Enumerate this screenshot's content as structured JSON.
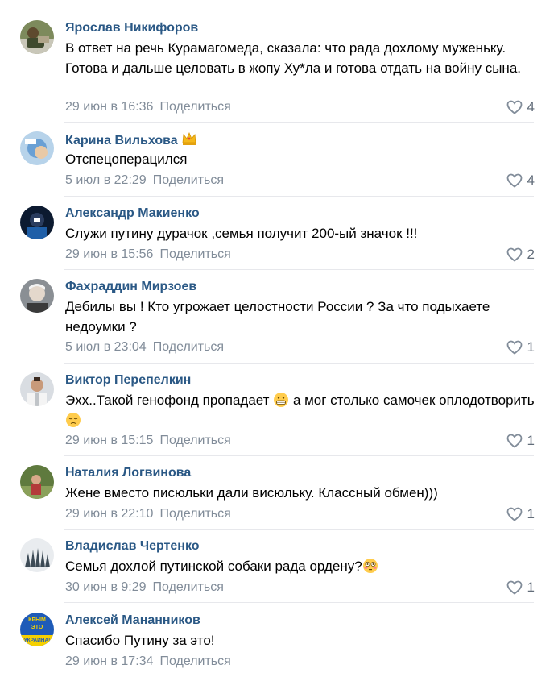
{
  "comments": [
    {
      "author": "Ярослав Никифоров",
      "text": "В ответ на речь Курамагомеда, сказала: что рада дохлому муженьку. Готова и дальше целовать в жопу Ху*ла и готова отдать на войну сына.",
      "date": "29 июн в 16:36",
      "share": "Поделиться",
      "likes": "4"
    },
    {
      "author": "Карина Вильхова",
      "text": "Отспецоперацился",
      "date": "5 июл в 22:29",
      "share": "Поделиться",
      "likes": "4"
    },
    {
      "author": "Александр Макиенко",
      "text": "Служи путину дурачок ,семья получит 200-ый значок !!!",
      "date": "29 июн в 15:56",
      "share": "Поделиться",
      "likes": "2"
    },
    {
      "author": "Фахраддин Мирзоев",
      "text": "Дебилы вы ! Кто угрожает целостности России ? За что подыхаете недоумки ?",
      "date": "5 июл в 23:04",
      "share": "Поделиться",
      "likes": "1"
    },
    {
      "author": "Виктор Перепелкин",
      "text_a": "Эхх..Такой генофонд пропадает",
      "text_b": "а мог столько самочек оплодотворить",
      "date": "29 июн в 15:15",
      "share": "Поделиться",
      "likes": "1"
    },
    {
      "author": "Наталия Логвинова",
      "text": "Жене вместо писюльки дали висюльку. Классный обмен)))",
      "date": "29 июн в 22:10",
      "share": "Поделиться",
      "likes": "1"
    },
    {
      "author": "Владислав Чертенко",
      "text": "Семья дохлой путинской собаки рада ордену?",
      "date": "30 июн в 9:29",
      "share": "Поделиться",
      "likes": "1"
    },
    {
      "author": "Алексей Мананников",
      "text": "Спасибо Путину за это!",
      "date": "29 июн в 17:34",
      "share": "Поделиться",
      "likes": ""
    }
  ],
  "avatar_badges": {
    "krym": [
      "КРЫМ",
      "ЭТО",
      "УКРАИНА!"
    ]
  },
  "icons": {
    "like": "heart-outline-icon",
    "crown": "crown-emoji-icon",
    "grimace": "grimacing-emoji-icon",
    "pensive": "pensive-emoji-icon",
    "flushed": "flushed-emoji-icon"
  },
  "colors": {
    "author": "#2a5885",
    "meta": "#818c99",
    "like": "#626d7a",
    "separator": "#e7e8ec"
  }
}
